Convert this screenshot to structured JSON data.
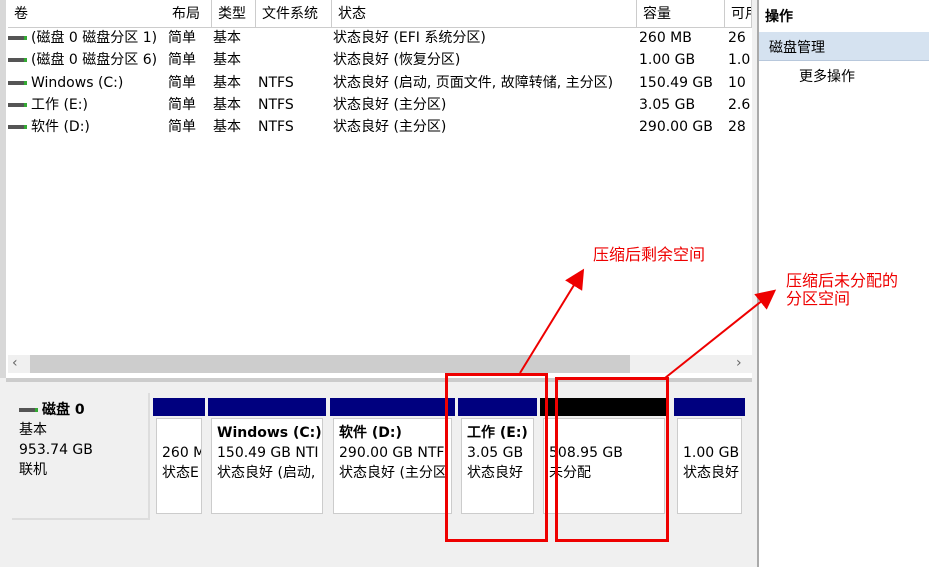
{
  "table": {
    "columns": [
      "卷",
      "布局",
      "类型",
      "文件系统",
      "状态",
      "容量",
      "可用"
    ],
    "rows": [
      [
        "(磁盘 0 磁盘分区 1)",
        "简单",
        "基本",
        "",
        "状态良好 (EFI 系统分区)",
        "260 MB",
        "26"
      ],
      [
        "(磁盘 0 磁盘分区 6)",
        "简单",
        "基本",
        "",
        "状态良好 (恢复分区)",
        "1.00 GB",
        "1.0"
      ],
      [
        "Windows (C:)",
        "简单",
        "基本",
        "NTFS",
        "状态良好 (启动, 页面文件, 故障转储, 主分区)",
        "150.49 GB",
        "10"
      ],
      [
        "工作 (E:)",
        "简单",
        "基本",
        "NTFS",
        "状态良好 (主分区)",
        "3.05 GB",
        "2.6"
      ],
      [
        "软件 (D:)",
        "简单",
        "基本",
        "NTFS",
        "状态良好 (主分区)",
        "290.00 GB",
        "28"
      ]
    ]
  },
  "scroll": {
    "left": "‹",
    "right": "›"
  },
  "actions": {
    "title": "操作",
    "section": "磁盘管理",
    "more": "更多操作"
  },
  "disk": {
    "name": "磁盘 0",
    "type": "基本",
    "size": "953.74 GB",
    "status": "联机"
  },
  "partitions": [
    {
      "title": "",
      "size": "260 M",
      "status": "状态E"
    },
    {
      "title": "Windows (C:)",
      "size": "150.49 GB NTI",
      "status": "状态良好 (启动,"
    },
    {
      "title": "软件 (D:)",
      "size": "290.00 GB NTF",
      "status": "状态良好 (主分区"
    },
    {
      "title": "工作 (E:)",
      "size": "3.05 GB",
      "status": "状态良好"
    },
    {
      "title": "",
      "size": "508.95 GB",
      "status": "未分配"
    },
    {
      "title": "",
      "size": "1.00 GB",
      "status": "状态良好"
    }
  ],
  "annotations": {
    "remaining": "压缩后剩余空间",
    "unallocated1": "压缩后未分配的",
    "unallocated2": "分区空间"
  },
  "colors": {
    "partition_bar": "#00007f",
    "unallocated_bar": "#000000",
    "annotation": "#e00000"
  }
}
